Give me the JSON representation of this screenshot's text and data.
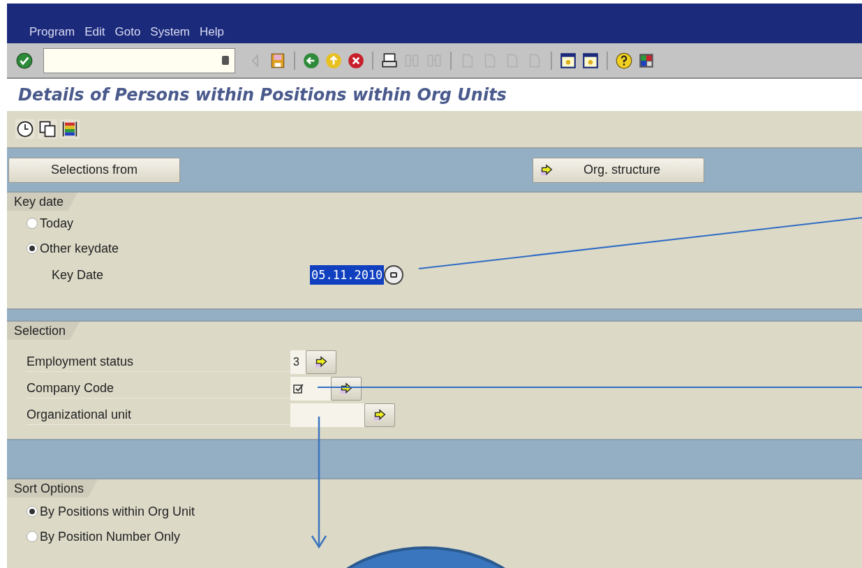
{
  "menu": [
    "Program",
    "Edit",
    "Goto",
    "System",
    "Help"
  ],
  "toolbar": [
    [
      {
        "kind": "enter",
        "disabled": false
      }
    ],
    [
      {
        "kind": "command",
        "disabled": false
      },
      {
        "kind": "triangle",
        "disabled": true
      },
      {
        "kind": "save",
        "disabled": false
      }
    ],
    [
      {
        "kind": "back",
        "disabled": false
      },
      {
        "kind": "exit",
        "disabled": false
      },
      {
        "kind": "cancel",
        "disabled": false
      }
    ],
    [
      {
        "kind": "print",
        "disabled": false
      },
      {
        "kind": "find",
        "disabled": true
      },
      {
        "kind": "find",
        "disabled": true
      }
    ],
    [
      {
        "kind": "page",
        "disabled": true
      },
      {
        "kind": "page",
        "disabled": true
      },
      {
        "kind": "page",
        "disabled": true
      },
      {
        "kind": "page",
        "disabled": true
      }
    ],
    [
      {
        "kind": "window",
        "disabled": false
      },
      {
        "kind": "window",
        "disabled": false
      }
    ],
    [
      {
        "kind": "help",
        "disabled": false
      },
      {
        "kind": "layout",
        "disabled": false
      }
    ]
  ],
  "title": "Details of Persons within Positions within Org Units",
  "app_toolbar": [
    {
      "kind": "clock"
    },
    {
      "kind": "copy"
    },
    {
      "kind": "colors"
    }
  ],
  "buttons": [
    {
      "label": "Selections from",
      "icon": false
    },
    {
      "label": "Org. structure",
      "icon": true
    }
  ],
  "key_date": {
    "title": "Key date",
    "options": [
      {
        "label": "Today",
        "selected": false
      },
      {
        "label": "Other keydate",
        "selected": true
      }
    ],
    "field_label": "Key Date",
    "field_value": "05.11.2010",
    "highlighted": true
  },
  "selection": {
    "title": "Selection",
    "rows": [
      {
        "label": "Employment status",
        "kind": "text",
        "value": "3"
      },
      {
        "label": "Company Code",
        "kind": "checkbox",
        "checked": true
      },
      {
        "label": "Organizational unit",
        "kind": "text"
      }
    ]
  },
  "sort_options": {
    "title": "Sort Options",
    "options": [
      {
        "label": "By Positions within Org Unit",
        "selected": true
      },
      {
        "label": "By Position Number Only",
        "selected": false
      }
    ]
  }
}
